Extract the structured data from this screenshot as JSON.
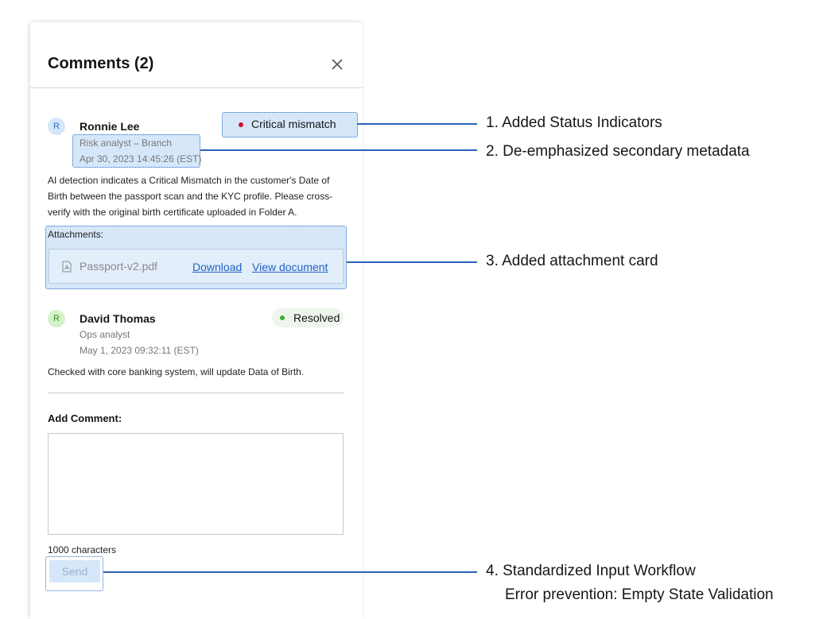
{
  "panel": {
    "title": "Comments (2)",
    "close_icon": "close-icon"
  },
  "comments": [
    {
      "avatar_initial": "R",
      "avatar_color": "#d4e6fa",
      "author": "Ronnie Lee",
      "role": "Risk analyst – Branch",
      "timestamp": "Apr 30, 2023 14:45:26 (EST)",
      "status": "Critical mismatch",
      "status_color": "#d0102b",
      "body": "AI detection indicates a Critical Mismatch in the customer's Date of Birth between the passport scan and the KYC profile. Please cross-verify with the original birth certificate uploaded in Folder A.",
      "attachments_label": "Attachments:",
      "attachment": {
        "file_name": "Passport-v2.pdf",
        "file_icon": "pdf-file-icon",
        "download_label": "Download",
        "view_label": "View document"
      }
    },
    {
      "avatar_initial": "R",
      "avatar_color": "#d5f2c9",
      "author": "David Thomas",
      "role": "Ops analyst",
      "timestamp": "May 1, 2023 09:32:11 (EST)",
      "status": "Resolved",
      "status_color": "#3fae3a",
      "body": "Checked with core banking system, will update Data of Birth."
    }
  ],
  "add_comment": {
    "label": "Add Comment:",
    "value": "",
    "char_limit_text": "1000 characters",
    "send_label": "Send"
  },
  "annotations": [
    {
      "text": "1. Added Status Indicators"
    },
    {
      "text": "2. De-emphasized secondary metadata"
    },
    {
      "text": "3. Added attachment card"
    },
    {
      "text": "4. Standardized Input Workflow",
      "subtext": "Error prevention: Empty State Validation"
    }
  ],
  "colors": {
    "accent": "#2a62b7",
    "highlight": "#d6e7fa",
    "link": "#1f62c4"
  }
}
